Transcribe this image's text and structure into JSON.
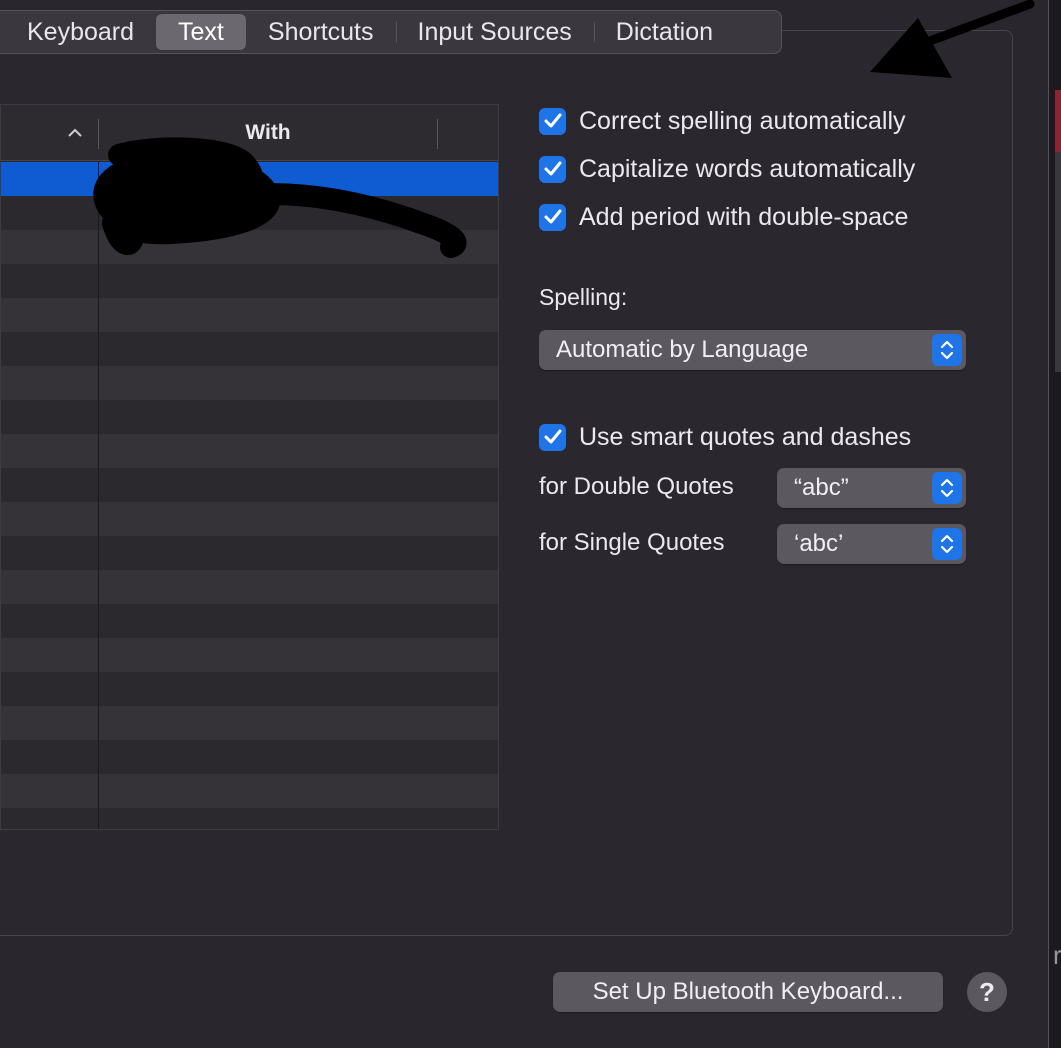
{
  "tabs": [
    {
      "label": "Keyboard",
      "selected": false
    },
    {
      "label": "Text",
      "selected": true
    },
    {
      "label": "Shortcuts",
      "selected": false
    },
    {
      "label": "Input Sources",
      "selected": false
    },
    {
      "label": "Dictation",
      "selected": false
    }
  ],
  "table": {
    "columns": {
      "replace": "",
      "with": "With"
    },
    "sort_icon": "chevron-up-icon",
    "row_count": 20,
    "selected_row": 0
  },
  "options": {
    "correct_spelling": {
      "label": "Correct spelling automatically",
      "checked": true
    },
    "capitalize_words": {
      "label": "Capitalize words automatically",
      "checked": true
    },
    "add_period": {
      "label": "Add period with double-space",
      "checked": true
    },
    "smart_quotes": {
      "label": "Use smart quotes and dashes",
      "checked": true
    }
  },
  "spelling": {
    "label": "Spelling:",
    "value": "Automatic by Language"
  },
  "double_quotes": {
    "label": "for Double Quotes",
    "value": "“abc”"
  },
  "single_quotes": {
    "label": "for Single Quotes",
    "value": "‘abc’"
  },
  "buttons": {
    "bluetooth": "Set Up Bluetooth Keyboard...",
    "help": "?"
  },
  "edge_text": "r",
  "colors": {
    "accent": "#1f74e8",
    "selection": "#0f5bd1",
    "background": "#2a262d"
  }
}
